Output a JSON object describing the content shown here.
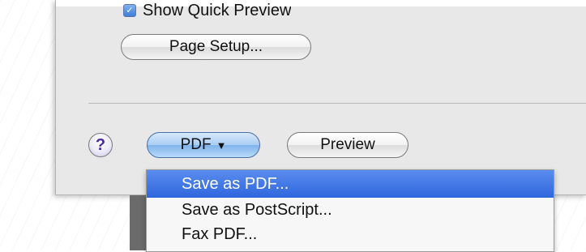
{
  "dialog": {
    "show_quick_preview_label": "Show Quick Preview",
    "show_quick_preview_checked": true,
    "page_setup_label": "Page Setup...",
    "help_label": "?",
    "pdf_label": "PDF",
    "pdf_caret": "▼",
    "preview_label": "Preview"
  },
  "pdf_menu": {
    "items": [
      {
        "label": "Save as PDF...",
        "selected": true
      },
      {
        "label": "Save as PostScript...",
        "selected": false
      },
      {
        "label": "Fax PDF...",
        "selected": false
      }
    ]
  },
  "colors": {
    "sheet_bg": "#e8e8e8",
    "menu_highlight": "#3b73e0",
    "help_glyph": "#4a2aa0"
  }
}
